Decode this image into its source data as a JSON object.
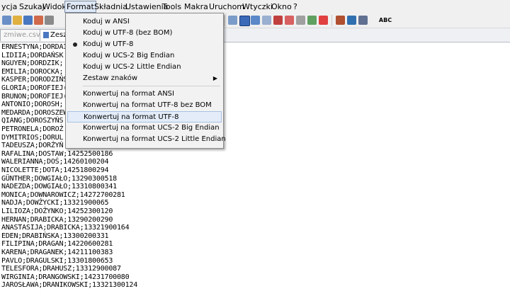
{
  "menubar": {
    "items": [
      "ycja",
      "Szukaj",
      "Widok",
      "Format",
      "Składnia",
      "Ustawienia",
      "Tools",
      "Makra",
      "Uruchom",
      "Wtyczki",
      "Okno",
      "?"
    ]
  },
  "tabs": {
    "tab1": "zmiwe.csv",
    "tab2": "Zeszy"
  },
  "format_menu": {
    "items": [
      {
        "label": "Koduj w ANSI",
        "selected": false
      },
      {
        "label": "Koduj w UTF-8 (bez BOM)",
        "selected": false
      },
      {
        "label": "Koduj w UTF-8",
        "selected": true
      },
      {
        "label": "Koduj w UCS-2 Big Endian",
        "selected": false
      },
      {
        "label": "Koduj w UCS-2 Little Endian",
        "selected": false
      },
      {
        "label": "Zestaw znaków",
        "submenu": true
      },
      {
        "label": "Konwertuj na format ANSI"
      },
      {
        "label": "Konwertuj na format UTF-8 bez BOM"
      },
      {
        "label": "Konwertuj na format UTF-8",
        "highlighted": true
      },
      {
        "label": "Konwertuj na format UCS-2 Big Endian"
      },
      {
        "label": "Konwertuj na format UCS-2 Little Endian"
      }
    ]
  },
  "editor": {
    "lines": [
      "ERNESTYNA;DORDAI",
      "LIDIIA;DORDAŃSK",
      "NGUYEN;DORDZIK;",
      "EMILIA;DOROCKA;",
      "KASPER;DORODZIŃS",
      "GLORIA;DOROFIEJ(",
      "BRUNON;DOROFIEJ(",
      "ANTONIO;DOROSH;",
      "MEDARDA;DOROSZEW",
      "QIANG;DOROSZYŃS",
      "PETRONELA;DOROŻ",
      "DYMITRIOS;DORUL",
      "TADEUSZA;DORŻYŃ",
      "RAFALINA;DOSTAW;14252500186",
      "WALERIANNA;DOŚ;14260100204",
      "NICOLETTE;DOTA;14251800294",
      "GÜNTHER;DOWGIAŁO;13290300518",
      "NADEZDA;DOWGIAŁO;13310800341",
      "MONICA;DOWNAROWICZ;14272700281",
      "NADJA;DOWŻYCKI;13321900065",
      "LILIOZA;DOŻYNKO;14252300120",
      "HERNAN;DRABICKA;13290200290",
      "ANASTASIJA;DRABICKA;13321900164",
      "EDEN;DRABIŃSKA;13300200331",
      "FILIPINA;DRAGAN;14220600281",
      "KARENA;DRAGANEK;14211100383",
      "PAVLO;DRAGULSKI;13301800653",
      "TELESFORA;DRAHUSZ;13312900087",
      "WIRGINIA;DRANGOWSKI;14231700080",
      "JAROSŁAWA;DRANIKOWSKI;13321300124"
    ]
  },
  "toolbar": {
    "icons": [
      "new-icon",
      "open-icon",
      "save-icon",
      "save-all-icon",
      "close-icon",
      "close-all-icon",
      "print-icon",
      "wrap-icon",
      "indent-guide-icon",
      "fold-icon",
      "zoom-icon",
      "macro-record-icon",
      "macro-stop-icon",
      "macro-play-icon",
      "spellcheck-icon"
    ],
    "spellcheck_label": "ABC"
  }
}
